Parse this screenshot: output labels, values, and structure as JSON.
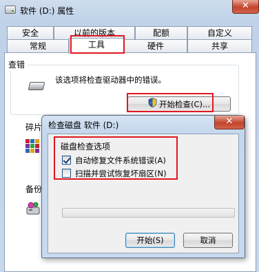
{
  "window": {
    "title": "软件 (D:) 属性",
    "close_glyph": "✕"
  },
  "tabs_row1": [
    "安全",
    "以前的版本",
    "配额",
    "自定义"
  ],
  "tabs_row2": [
    "常规",
    "工具",
    "硬件",
    "共享"
  ],
  "active_tab": "工具",
  "error_checking": {
    "group_label": "查错",
    "description": "该选项将检查驱动器中的错误。",
    "button_label": "开始检查(C)..."
  },
  "defrag": {
    "group_label": "碎片"
  },
  "backup": {
    "group_label": "备份"
  },
  "dialog": {
    "title": "检查磁盘 软件 (D:)",
    "close_glyph": "✕",
    "options_label": "磁盘检查选项",
    "options": [
      {
        "label": "自动修复文件系统错误(A)",
        "checked": true
      },
      {
        "label": "扫描并尝试恢复坏扇区(N)",
        "checked": false
      }
    ],
    "progress": 0,
    "start_button": "开始(S)",
    "cancel_button": "取消"
  },
  "colors": {
    "highlight_box": "#e0161f",
    "default_button_border": "#3c7fb1",
    "close_button": "#c3442c"
  }
}
